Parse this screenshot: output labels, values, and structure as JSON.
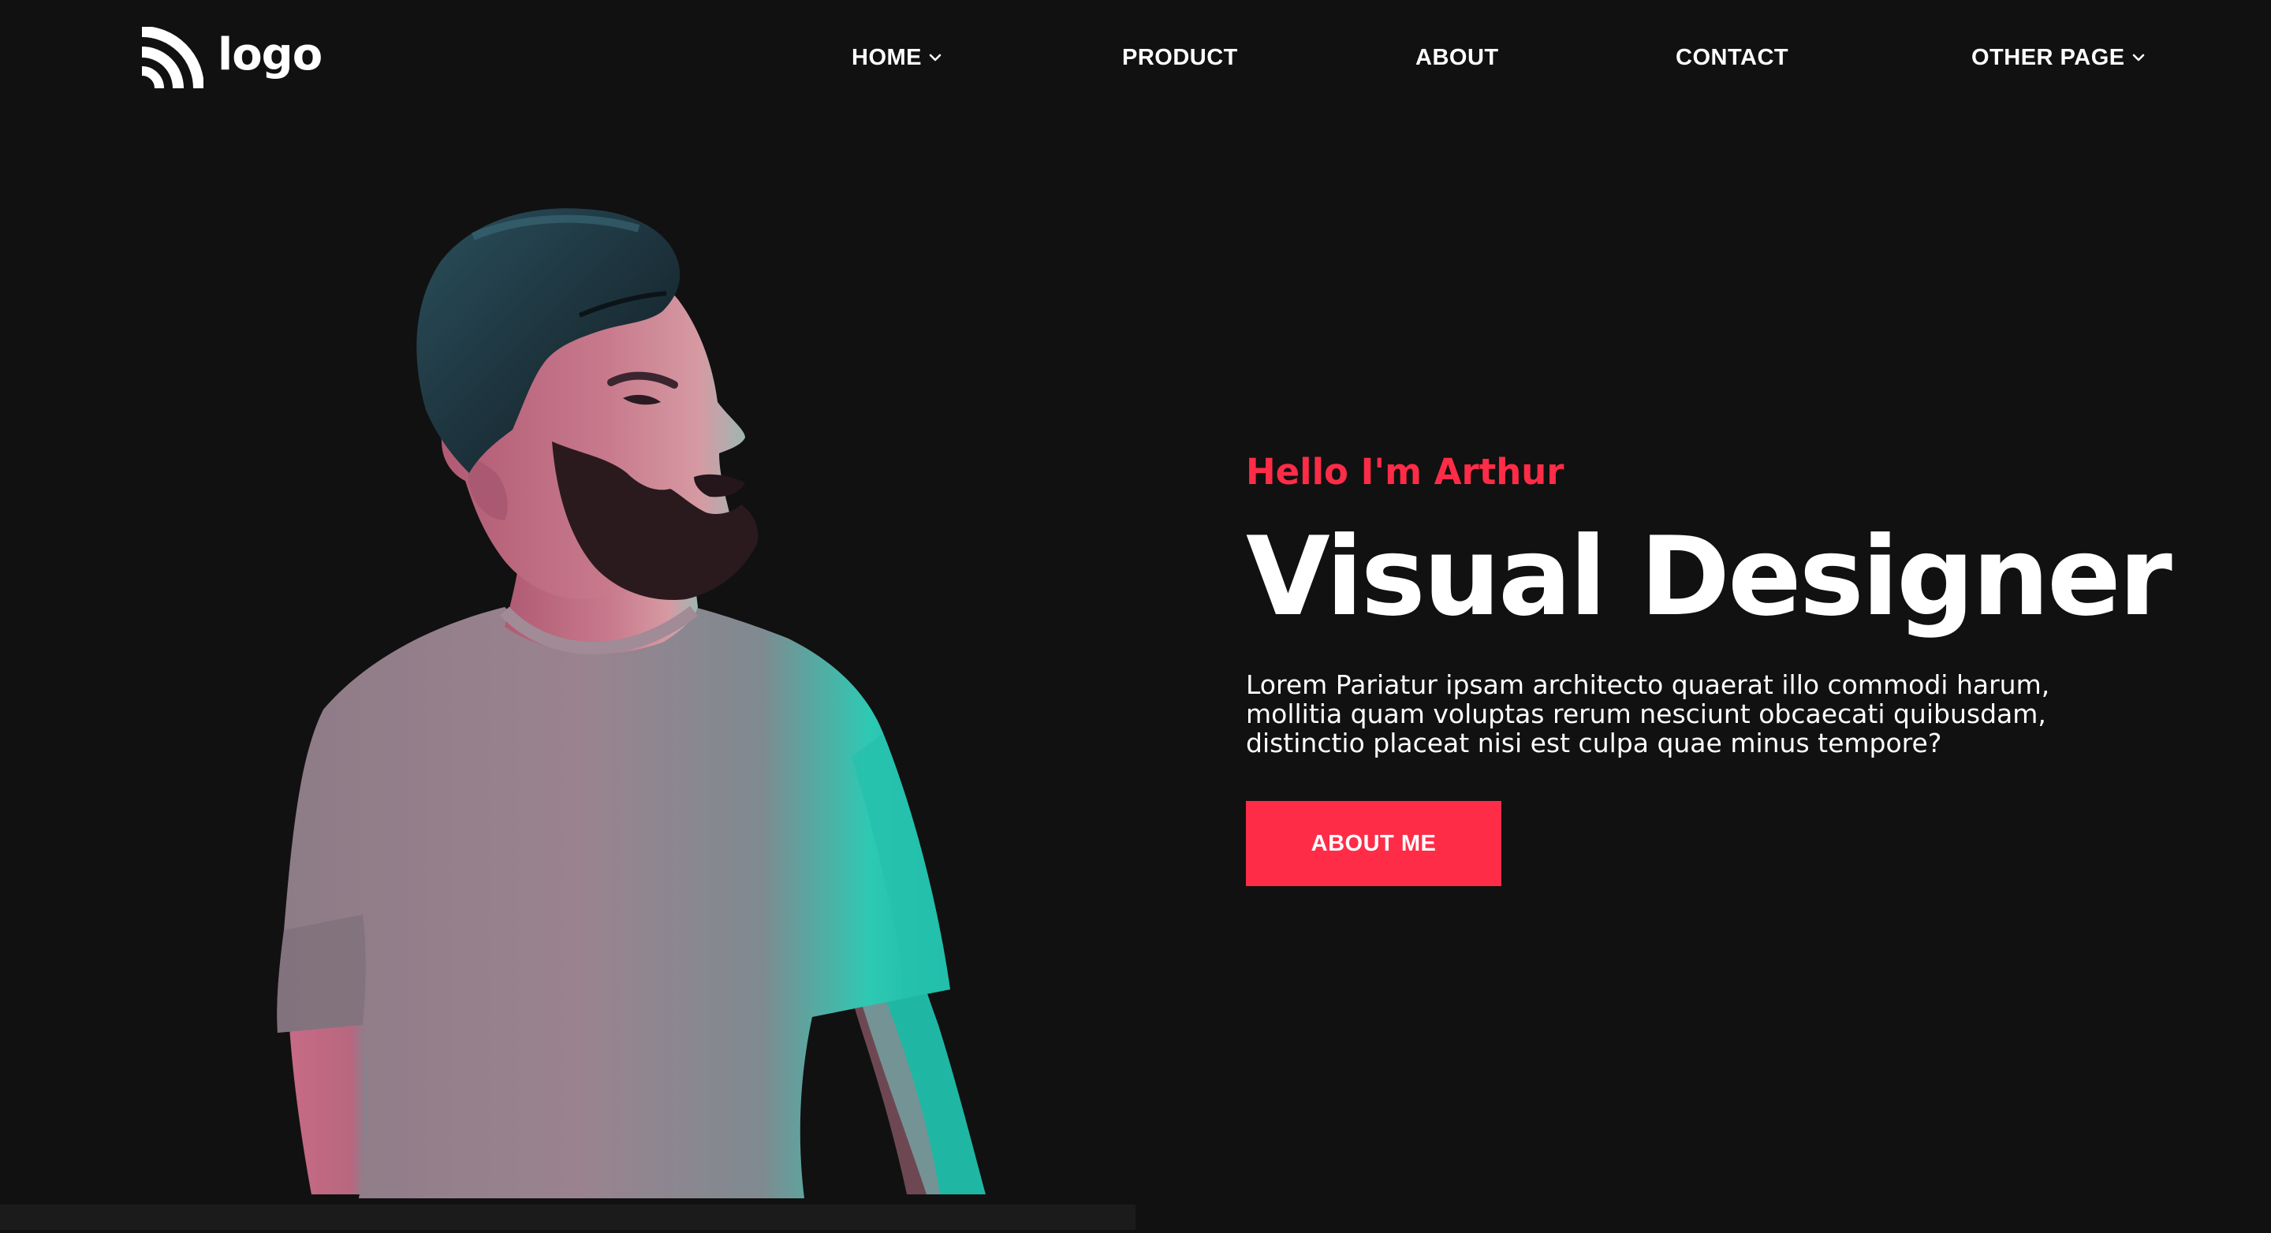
{
  "header": {
    "logo_text": "logo",
    "logo_icon": "signal-arcs-icon",
    "nav": [
      {
        "label": "HOME",
        "has_dropdown": true
      },
      {
        "label": "PRODUCT",
        "has_dropdown": false
      },
      {
        "label": "ABOUT",
        "has_dropdown": false
      },
      {
        "label": "CONTACT",
        "has_dropdown": false
      },
      {
        "label": "OTHER PAGE",
        "has_dropdown": true
      }
    ],
    "dropdown_icon": "chevron-down-icon"
  },
  "hero": {
    "greeting": "Hello I'm Arthur",
    "title": "Visual Designer",
    "description_lines": [
      "Lorem Pariatur ipsam architecto quaerat illo commodi harum,",
      "mollitia quam voluptas rerum nesciunt obcaecati quibusdam,",
      "distinctio placeat nisi est culpa quae minus tempore?"
    ],
    "button_label": "ABOUT ME"
  },
  "colors": {
    "background": "#111111",
    "accent": "#ff2c48",
    "text": "#ffffff",
    "photo_highlight_cyan": "#1fc9b8",
    "photo_highlight_pink": "#d9728a"
  }
}
